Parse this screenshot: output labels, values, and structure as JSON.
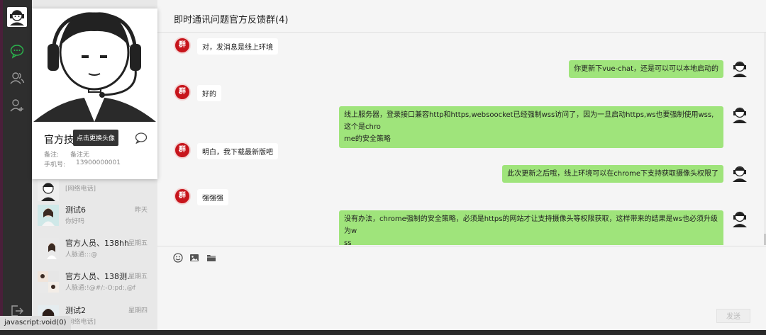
{
  "chat_header": {
    "title": "即时通讯问题官方反馈群(4)"
  },
  "messages": [
    {
      "side": "left",
      "text": "对，发消息是线上环境",
      "avatar": "群"
    },
    {
      "side": "right",
      "text": "你更新下vue-chat，还是可以可以本地启动的"
    },
    {
      "side": "left",
      "text": "好的",
      "avatar": "群"
    },
    {
      "side": "right",
      "line1": "线上服务器，登录接口兼容http和https,websoocket已经强制wss访问了，因为一旦启动https,ws也要强制使用wss,这个是chro",
      "line2": "me的安全策略"
    },
    {
      "side": "left",
      "text": "明白，我下载最新版吧",
      "avatar": "群"
    },
    {
      "side": "right",
      "text": "此次更新之后哦，线上环境可以在chrome下支持获取摄像头权限了"
    },
    {
      "side": "left",
      "text": "强强强",
      "avatar": "群"
    },
    {
      "side": "right",
      "line1": "没有办法，chrome强制的安全策略，必须是https的网站才让支持摄像头等权限获取，这样带来的结果是ws也必须升级为w",
      "line2": "ss"
    }
  ],
  "profile_card": {
    "name": "官方技",
    "tooltip": "点击更换头像",
    "remark_label": "备注:",
    "remark_value": "备注无",
    "phone_label": "手机号:",
    "phone_value": "13900000001"
  },
  "contacts": [
    {
      "name": "",
      "subtitle": "[网络电话]",
      "time": ""
    },
    {
      "name": "测试6",
      "subtitle": "你好吗",
      "time": "昨天"
    },
    {
      "name": "官方人员、138hh",
      "subtitle": "人脉通:::@",
      "time": "星期五"
    },
    {
      "name": "官方人员、138测…",
      "subtitle": "人脉通:!@#/:-O:pd:,@f",
      "time": "星期五"
    },
    {
      "name": "测试2",
      "subtitle": "[网络电话]",
      "time": "星期四"
    }
  ],
  "composer": {
    "send_label": "发送"
  },
  "statusbar": {
    "text": "javascript:void(0)"
  },
  "icons": {
    "nav": [
      "chat-icon",
      "contacts-icon",
      "add-friend-icon",
      "logout-icon"
    ],
    "toolbar": [
      "emoji-icon",
      "image-icon",
      "folder-icon"
    ]
  },
  "colors": {
    "nav_bg": "#2e2e2e",
    "active_green": "#2bb24c",
    "bubble_right": "#9fe47b",
    "group_red": "#c7151c"
  }
}
